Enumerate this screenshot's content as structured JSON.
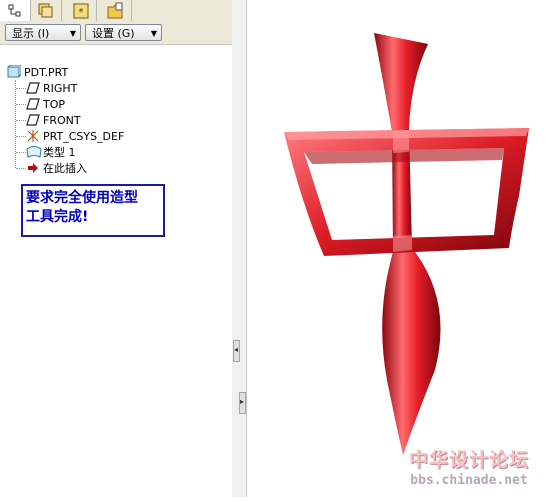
{
  "tabs": [
    {
      "icon": "model-tree-icon"
    },
    {
      "icon": "layers-icon"
    },
    {
      "icon": "favorites-icon"
    },
    {
      "icon": "folder-icon"
    }
  ],
  "toolbar": {
    "show_label": "显示 (I)",
    "settings_label": "设置 (G)"
  },
  "tree": {
    "root": "PDT.PRT",
    "items": [
      {
        "label": "RIGHT",
        "icon": "datum-plane-icon"
      },
      {
        "label": "TOP",
        "icon": "datum-plane-icon"
      },
      {
        "label": "FRONT",
        "icon": "datum-plane-icon"
      },
      {
        "label": "PRT_CSYS_DEF",
        "icon": "csys-icon"
      },
      {
        "label": "类型 1",
        "icon": "style-feature-icon"
      },
      {
        "label": "在此插入",
        "icon": "insert-arrow-icon"
      }
    ]
  },
  "note": {
    "line1": "要求完全使用造型",
    "line2": "工具完成!"
  },
  "watermark": {
    "title": "中华设计论坛",
    "url": "bbs.chinade.net"
  },
  "colors": {
    "model_red": "#e0202a",
    "note_blue": "#0000b8",
    "panel_bg": "#ece9d8"
  }
}
